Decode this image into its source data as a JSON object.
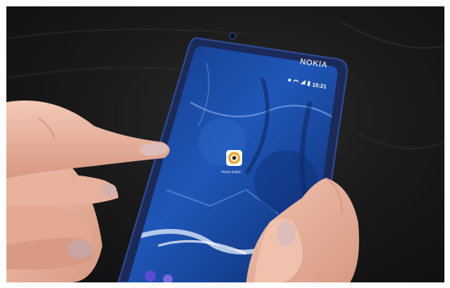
{
  "photo": {
    "subject": "hands holding smartphone",
    "phone": {
      "brand": "NOKIA",
      "status_bar": {
        "time": "10:21",
        "icons": [
          "location-icon",
          "wifi-icon",
          "signal-icon",
          "battery-icon"
        ]
      },
      "home_app": {
        "icon": "app-icon",
        "label": "Photo Editor"
      },
      "dock_icons": [
        "phone-icon",
        "contacts-icon"
      ]
    },
    "colors": {
      "background": "#1a1a1b",
      "phone_frame": "#1d2b5a",
      "screen_blue": "#1f4fa6",
      "skin": "#e7b39f",
      "nail": "#d9b8b4"
    }
  }
}
